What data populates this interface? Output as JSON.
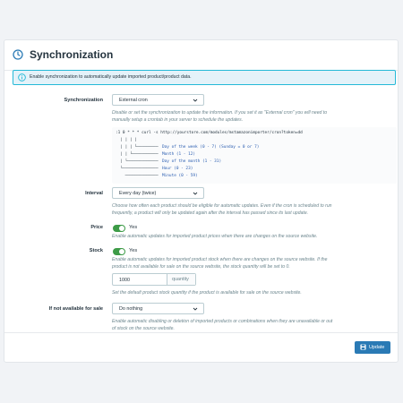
{
  "header": {
    "title": "Synchronization",
    "icon": "clock-sync-icon"
  },
  "alert": {
    "text": "Enable synchronization to automatically update imported product/product data.",
    "icon": "info-icon"
  },
  "sync": {
    "label": "Synchronization",
    "value": "External cron",
    "help": [
      "Disable or set the synchronization to update the information. If you set it as \"External cron\" you will need to",
      "manually setup a crontab in your server to schedule the updates."
    ],
    "cron": {
      "command": ":1 0 * * * curl -s http://yourstore.com/modules/mstamazonimporter/cron?token=dd",
      "lines": [
        {
          "tree": "  | | | |",
          "text": ""
        },
        {
          "tree": "  | | | └─────────",
          "text": "Day of the week (0 - 7) (Sunday = 0 or 7)"
        },
        {
          "tree": "  | | └───────────",
          "text": "Month (1 - 12)"
        },
        {
          "tree": "  | └─────────────",
          "text": "Day of the month (1 - 31)"
        },
        {
          "tree": "  └───────────────",
          "text": "Hour (0 - 23)"
        },
        {
          "tree": "    ──────────────",
          "text": "Minute (0 - 59)"
        }
      ]
    }
  },
  "interval": {
    "label": "Interval",
    "value": "Every day (twice)",
    "help": [
      "Choose how often each product should be eligible for automatic updates. Even if the cron is scheduled to run",
      "frequently, a product will only be updated again after the interval has passed since its last update."
    ]
  },
  "price": {
    "label": "Price",
    "toggle": "Yes",
    "help": "Enable automatic updates for imported product prices when there are changes on the source website."
  },
  "stock": {
    "label": "Stock",
    "toggle": "Yes",
    "help": [
      "Enable automatic updates for imported product stock when there are changes on the source website. If the",
      "product is not available for sale on the source website, the stock quantity will be set to 0."
    ],
    "quantity_value": "1000",
    "quantity_addon": "quantity",
    "quantity_help": "Set the default product stock quantity if the product is available for sale on the source website."
  },
  "unavailable": {
    "label": "If not available for sale",
    "value": "Do nothing",
    "help": [
      "Enable automatic disabling or deletion of imported products or combinations when they are unavailable or out",
      "of stock on the source website."
    ]
  },
  "footer": {
    "update_label": "Update",
    "icon": "save-icon"
  },
  "colors": {
    "primary": "#2a7ab5",
    "toggle_on": "#3d9b47",
    "alert_border": "#25b9d7",
    "alert_bg": "#e4f2f9"
  }
}
